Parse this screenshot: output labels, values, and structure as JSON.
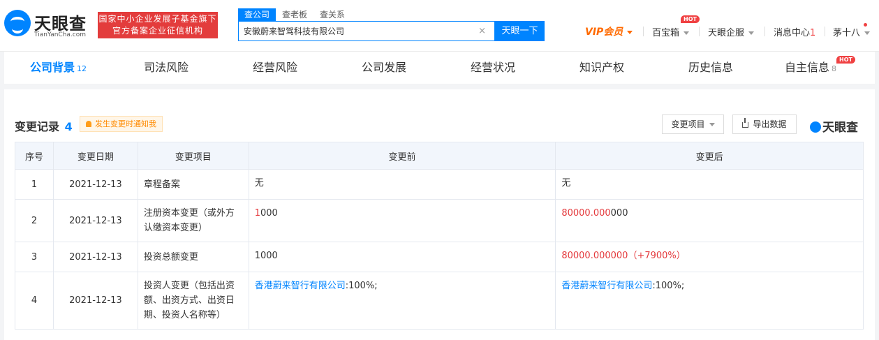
{
  "header": {
    "logo_cn": "天眼查",
    "logo_en": "TianYanCha.com",
    "badge_line1": "国家中小企业发展子基金旗下",
    "badge_line2": "官方备案企业征信机构",
    "search_tabs": [
      "查公司",
      "查老板",
      "查关系"
    ],
    "search_value": "安徽蔚来智驾科技有限公司",
    "search_button": "天眼一下",
    "clear_icon": "×",
    "vip_label": "VIP会员",
    "baobao_label": "百宝箱",
    "hot_label": "HOT",
    "qiyun_label": "天眼企服",
    "msg_label": "消息中心",
    "msg_count": "1",
    "user_label": "茅十八"
  },
  "tabs": [
    {
      "label": "公司背景",
      "count": "12"
    },
    {
      "label": "司法风险"
    },
    {
      "label": "经营风险"
    },
    {
      "label": "公司发展"
    },
    {
      "label": "经营状况"
    },
    {
      "label": "知识产权"
    },
    {
      "label": "历史信息"
    },
    {
      "label": "自主信息",
      "count": "8"
    }
  ],
  "section": {
    "title": "变更记录",
    "count": "4",
    "notify_label": "发生变更时通知我",
    "filter_label": "变更项目",
    "export_label": "导出数据",
    "brand": "天眼查"
  },
  "table": {
    "headers": [
      "序号",
      "变更日期",
      "变更项目",
      "变更前",
      "变更后"
    ],
    "rows": [
      {
        "no": "1",
        "date": "2021-12-13",
        "item": "章程备案",
        "before": "无",
        "after": "无"
      },
      {
        "no": "2",
        "date": "2021-12-13",
        "item": "注册资本变更（或外方认缴资本变更）",
        "before_hl": "1",
        "before": "000",
        "after_hl": "80000.000",
        "after": "000"
      },
      {
        "no": "3",
        "date": "2021-12-13",
        "item": "投资总额变更",
        "before": "1000",
        "after_hl": "80000.000000（+7900%）"
      },
      {
        "no": "4",
        "date": "2021-12-13",
        "item": "投资人变更（包括出资额、出资方式、出资日期、投资人名称等）",
        "before_link": "香港蔚来智行有限公司",
        "before": ":100%;",
        "after_link": "香港蔚来智行有限公司",
        "after": ":100%;"
      }
    ]
  },
  "colors": {
    "accent": "#0084ff",
    "highlight": "#e4393c",
    "badge": "#e33c3c",
    "vip": "#ff6a00"
  }
}
